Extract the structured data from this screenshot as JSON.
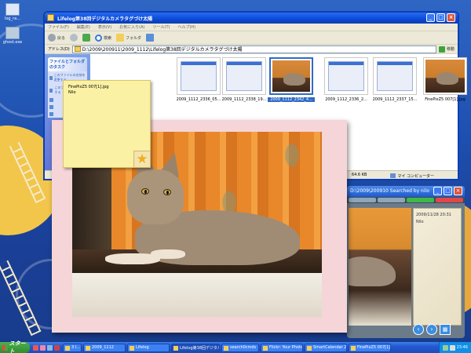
{
  "desktop": {
    "icons": [
      {
        "label": "log_ra..."
      },
      {
        "label": "ghost.exe"
      }
    ]
  },
  "explorer": {
    "title": "Lifelog第38回デジタルカメラタグづけ太陽",
    "menu": [
      "ファイル(F)",
      "編集(E)",
      "表示(V)",
      "お気に入り(A)",
      "ツール(T)",
      "ヘルプ(H)"
    ],
    "toolbar": {
      "back": "戻る",
      "search": "検索",
      "folders": "フォルダ"
    },
    "address_label": "アドレス(D)",
    "address_value": "D:\\2009\\200911\\2009_1112\\Lifelog第38回デジタルカメラタグづけ太陽",
    "go_label": "移動",
    "taskpane": {
      "header": "ファイルとフォルダのタスク",
      "items": [
        "このファイルの名前を変更する",
        "このファイルを移動する",
        "",
        "",
        ""
      ]
    },
    "files": [
      {
        "caption": "2009_1112_2336_05..."
      },
      {
        "caption": "2009_1112_2338_19..."
      },
      {
        "caption": "2009_1112_2342_4..."
      },
      {
        "caption": "2009_1112_2336_2..."
      },
      {
        "caption": "2009_1112_2337_15..."
      },
      {
        "caption": "FinePixZ5 007[1].jpg"
      }
    ],
    "status": {
      "size": "64.6 KB",
      "location": "マイ コンピューター"
    }
  },
  "sticky_note": {
    "line1": "FinePixZ5 007[1].jpg",
    "line2": "Nilo"
  },
  "viewer": {
    "title": "D:\\2009\\200910  Searched by nilo",
    "date": "2009/11/28 20:31",
    "name": "Nilo"
  },
  "taskbar": {
    "start": "スタート",
    "tasks": [
      "3 l...",
      "2009_1112",
      "Lifelog",
      "Lifelog第38回デジタル...",
      "search0cmds",
      "Flickr: Your Photos...",
      "SmartCalendar 2009...",
      "FinePixZ5 007[1].jp..."
    ],
    "clock": "23:46"
  }
}
